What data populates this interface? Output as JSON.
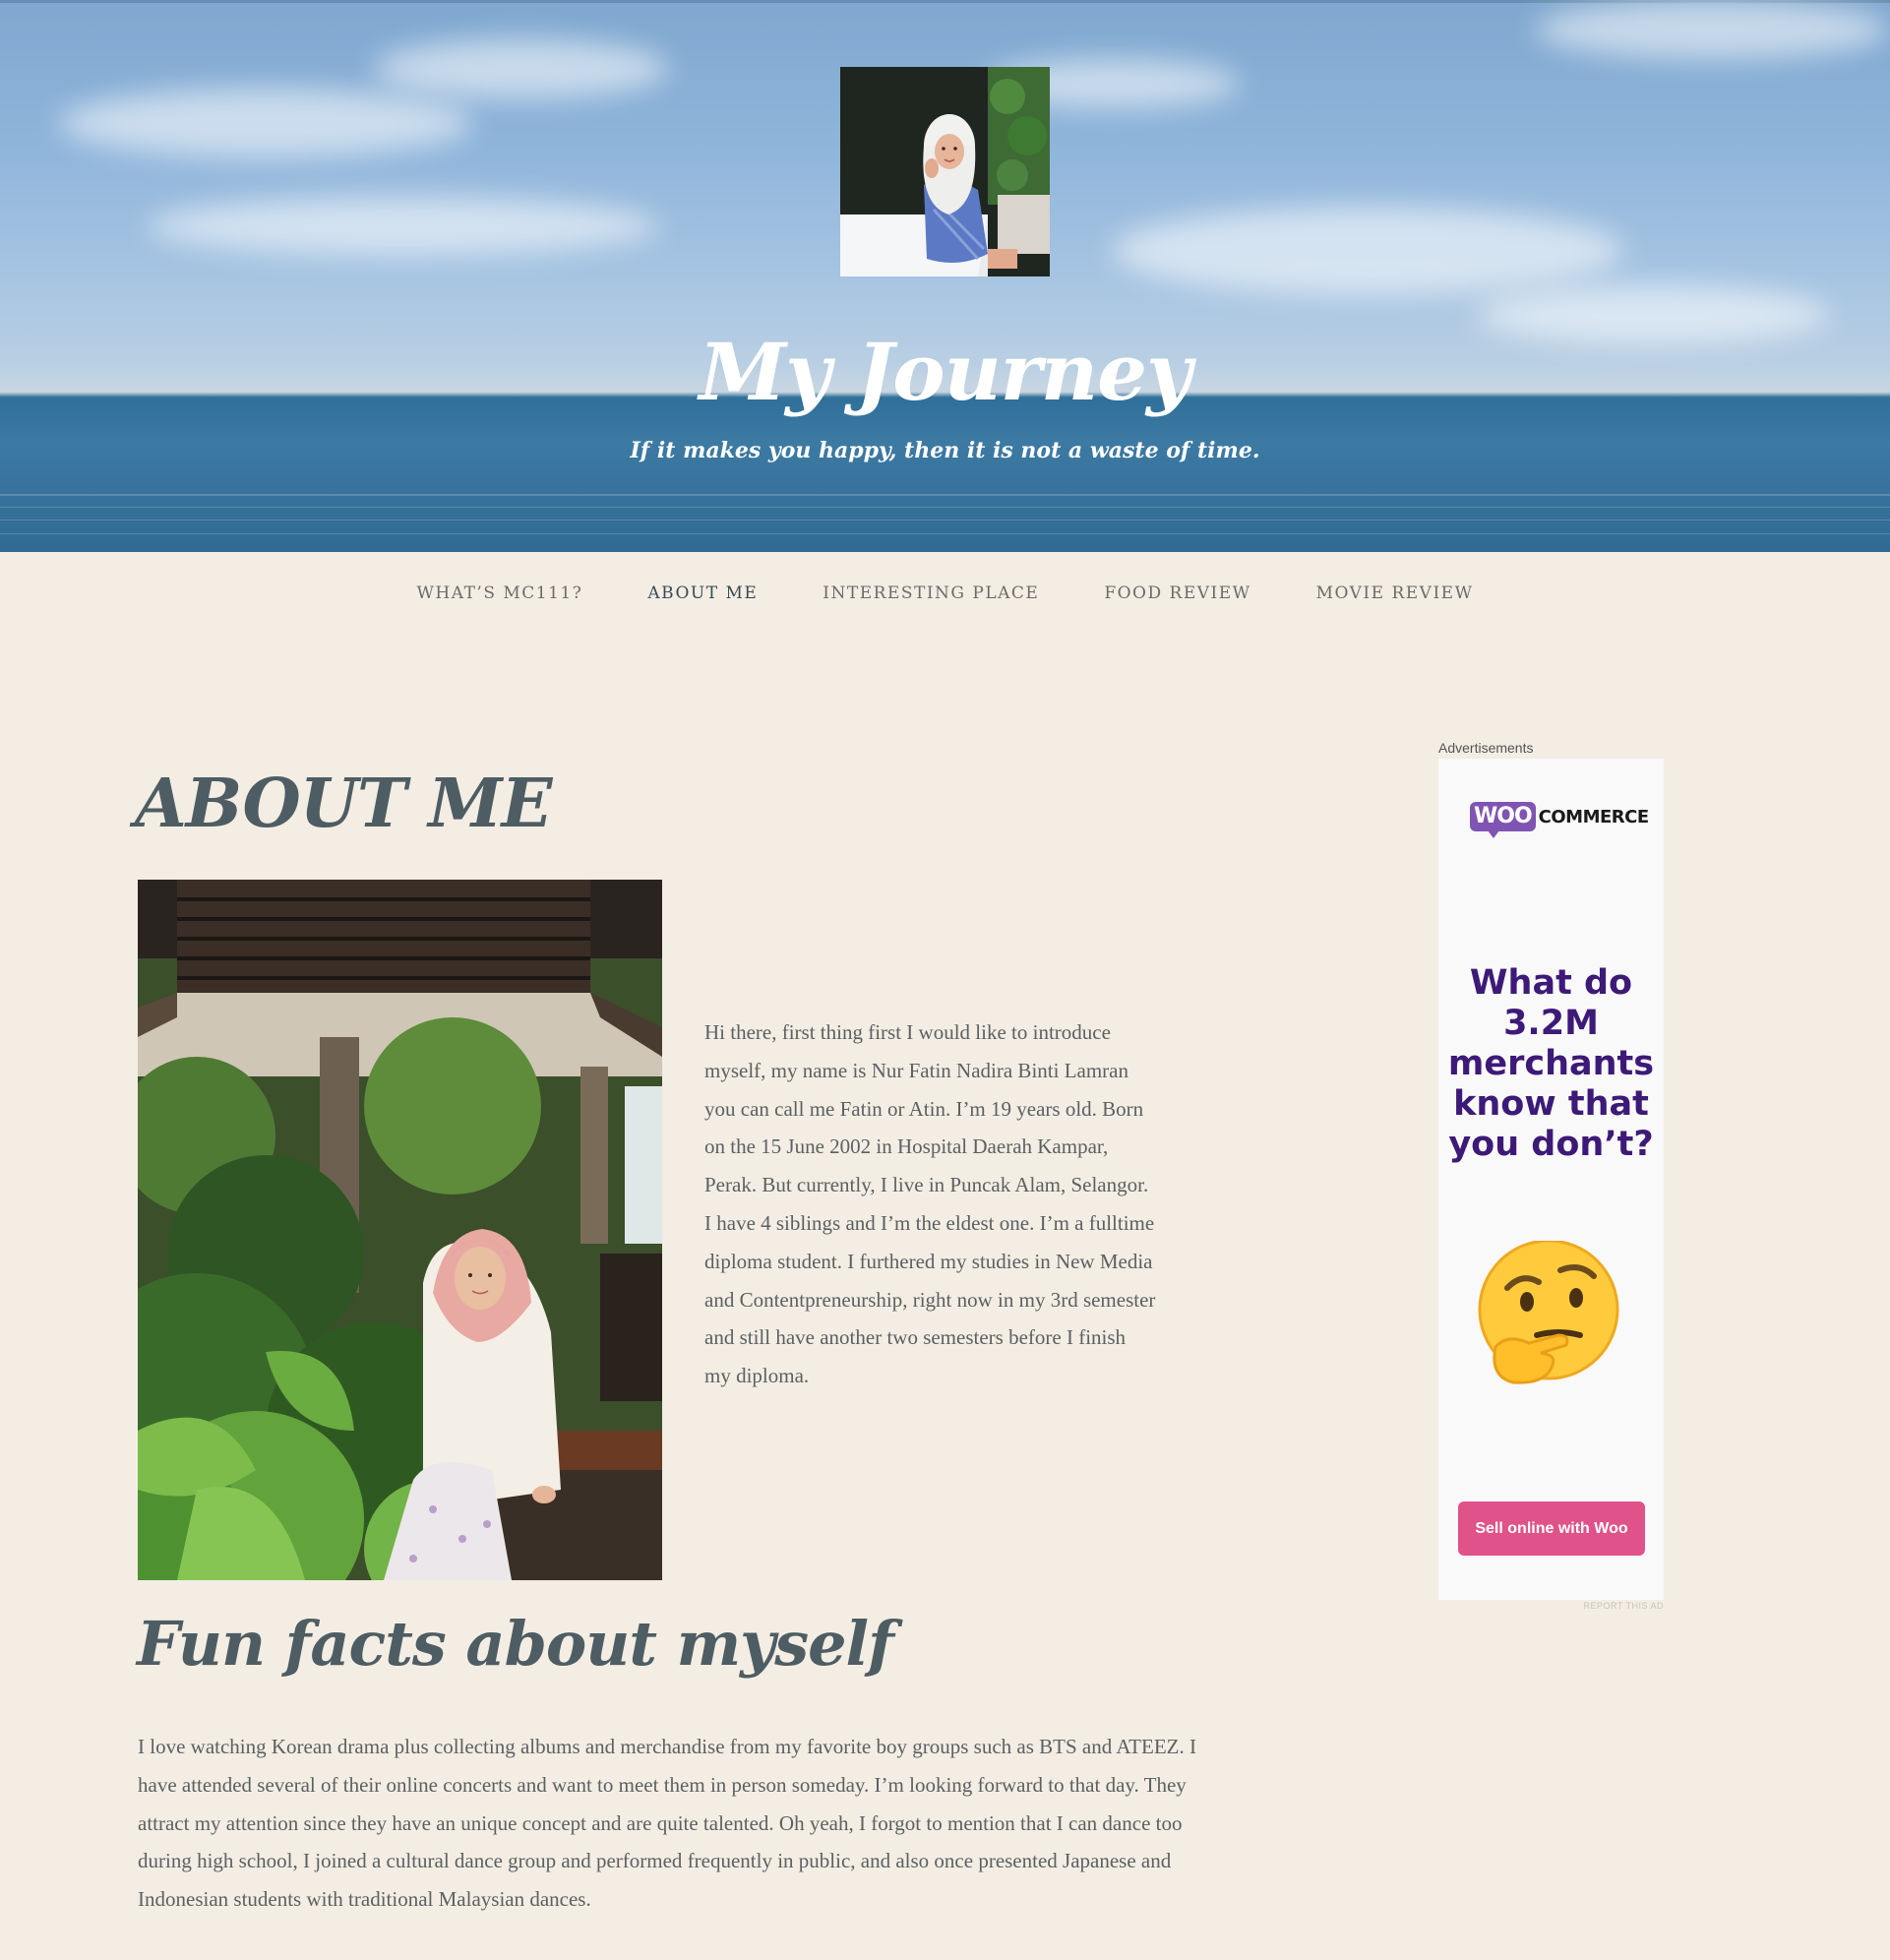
{
  "header": {
    "title": "My Journey",
    "tagline": "If it makes you happy, then it is not a waste of time."
  },
  "nav": {
    "items": [
      {
        "label": "WHAT’S MC111?"
      },
      {
        "label": "ABOUT ME",
        "current": true
      },
      {
        "label": "INTERESTING PLACE"
      },
      {
        "label": "FOOD REVIEW"
      },
      {
        "label": "MOVIE REVIEW"
      }
    ]
  },
  "main": {
    "page_title": "ABOUT ME",
    "intro": "Hi there, first thing first I would like to introduce myself, my name is Nur Fatin Nadira Binti Lamran you can call me Fatin or Atin. I’m 19 years old. Born on the 15 June 2002 in Hospital Daerah Kampar, Perak. But currently, I live in Puncak Alam, Selangor. I have 4 siblings and I’m the eldest one. I’m a fulltime diploma student. I furthered my studies in New Media and Contentpreneurship, right now in my 3rd semester and still have another two semesters before I finish my diploma.",
    "section_heading": "Fun facts about myself",
    "facts": "I love watching Korean drama plus collecting albums and merchandise from my favorite boy groups such as BTS and ATEEZ. I have attended several of their online concerts and want to meet them in person someday. I’m looking forward to that day. They attract my attention since they have an unique concept and are quite talented. Oh yeah, I forgot to mention that I can dance too during high school, I joined a cultural dance group and performed frequently in public, and also once presented Japanese and Indonesian students with traditional Malaysian dances."
  },
  "ad": {
    "label": "Advertisements",
    "brand_badge": "WOO",
    "brand_word": "COMMERCE",
    "headline": "What do 3.2M merchants know that you don’t?",
    "emoji": "thinking-face",
    "cta": "Sell online with Woo",
    "report": "REPORT THIS AD"
  },
  "colors": {
    "background": "#f3ede3",
    "heading": "#4e5d63",
    "body_text": "#5c6063",
    "woo_purple": "#7f54b3",
    "ad_headline": "#3d1a78",
    "ad_button": "#e0528a"
  }
}
